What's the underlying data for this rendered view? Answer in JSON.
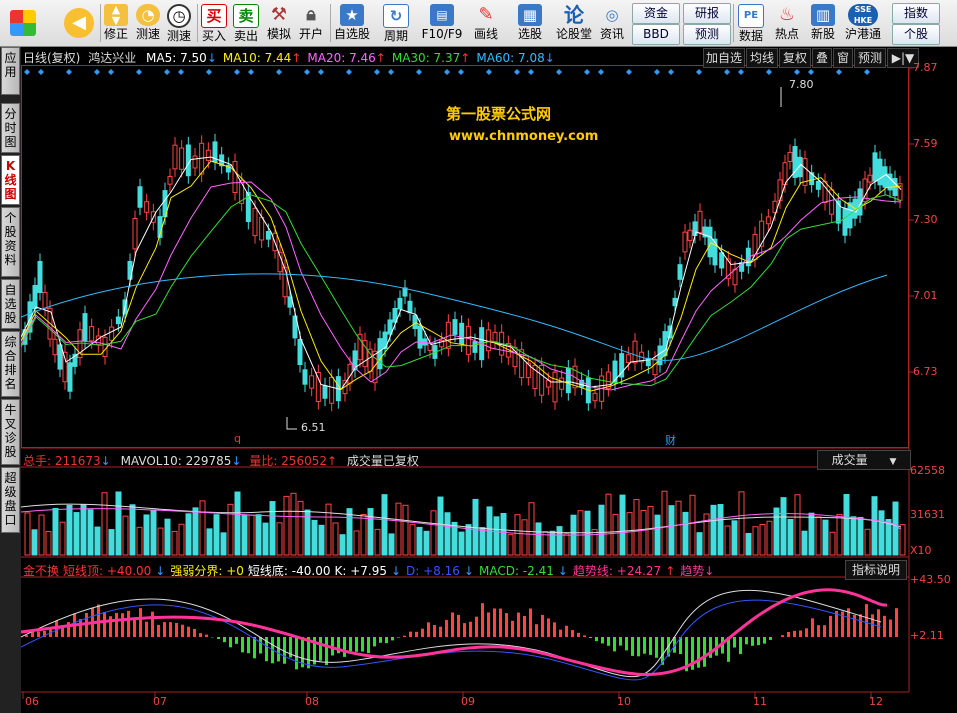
{
  "toolbar": {
    "buttons": [
      {
        "key": "back",
        "label": "",
        "icon": "back-arrow-icon"
      },
      {
        "key": "adjust",
        "label": "修正",
        "icon": "updown-arrows-icon"
      },
      {
        "key": "test",
        "label": "测速",
        "icon": "clock-icon"
      },
      {
        "key": "buy",
        "label": "买入",
        "icon": "buy-icon",
        "glyph": "买"
      },
      {
        "key": "sell",
        "label": "卖出",
        "icon": "sell-icon",
        "glyph": "卖"
      },
      {
        "key": "sim",
        "label": "模拟",
        "icon": "hammer-icon"
      },
      {
        "key": "open",
        "label": "开户",
        "icon": "lock-icon"
      },
      {
        "key": "watch",
        "label": "自选股",
        "icon": "star-folder-icon"
      },
      {
        "key": "period",
        "label": "周期",
        "icon": "cycle-icon"
      },
      {
        "key": "f10",
        "label": "F10/F9",
        "icon": "f10-icon"
      },
      {
        "key": "draw",
        "label": "画线",
        "icon": "pen-icon"
      },
      {
        "key": "pick",
        "label": "选股",
        "icon": "pick-icon"
      },
      {
        "key": "forum",
        "label": "论股堂",
        "icon": "forum-icon"
      },
      {
        "key": "info",
        "label": "资讯",
        "icon": "info-icon"
      },
      {
        "key": "data",
        "label": "数据",
        "icon": "pe-icon",
        "glyph": "PE"
      },
      {
        "key": "hot",
        "label": "热点",
        "icon": "hot-icon"
      },
      {
        "key": "ipo",
        "label": "新股",
        "icon": "news-icon"
      },
      {
        "key": "hkconnect",
        "label": "沪港通",
        "icon": "sse-hkex-icon"
      }
    ],
    "small": {
      "fund": "资金",
      "research": "研报",
      "index": "指数",
      "bbd": "BBD",
      "forecast": "预测",
      "personal": "个股"
    }
  },
  "lefttabs": [
    "应用",
    "分时图",
    "K线图",
    "个股资料",
    "自选股",
    "综合排名",
    "牛叉诊股",
    "超级盘口"
  ],
  "kline": {
    "title": "日线(复权)",
    "stock": "鸿达兴业",
    "ma": [
      {
        "label": "MA5: 7.50",
        "color": "#ffffff",
        "arrow": "down"
      },
      {
        "label": "MA10: 7.44",
        "color": "#ffee00",
        "arrow": "up"
      },
      {
        "label": "MA20: 7.46",
        "color": "#ff66ff",
        "arrow": "up"
      },
      {
        "label": "MA30: 7.37",
        "color": "#33dd33",
        "arrow": "up"
      },
      {
        "label": "MA60: 7.08",
        "color": "#33bbff",
        "arrow": "down"
      }
    ],
    "buttons": [
      "加自选",
      "均线",
      "复权",
      "叠",
      "窗",
      "预测"
    ],
    "watermark1": "第一股票公式网",
    "watermark2": "www.chnmoney.com",
    "high_label": "7.80",
    "low_label": "6.51",
    "marker_q": "q",
    "marker_cai": "财",
    "yaxis": [
      "7.87",
      "7.59",
      "7.30",
      "7.01",
      "6.73"
    ]
  },
  "volume": {
    "total": "总手: 211673",
    "mavol": "MAVOL10: 229785",
    "ratio": "量比: 256052",
    "note": "成交量已复权",
    "select": "成交量",
    "yaxis": [
      "62558",
      "31631",
      "X10"
    ]
  },
  "indicator": {
    "items": [
      {
        "label": "金不换",
        "color": "#ff3333"
      },
      {
        "label": "短线顶: +40.00",
        "color": "#ff3333",
        "arrow": "down"
      },
      {
        "label": "强弱分界: +0",
        "color": "#ffee00"
      },
      {
        "label": "短线底: -40.00",
        "color": "#ffffff"
      },
      {
        "label": "K: +7.95",
        "color": "#ffffff",
        "arrow": "down"
      },
      {
        "label": "D: +8.16",
        "color": "#3355ff",
        "arrow": "down"
      },
      {
        "label": "MACD: -2.41",
        "color": "#33dd33",
        "arrow": "down"
      },
      {
        "label": "趋势线: +24.27",
        "color": "#ff3399",
        "arrow": "up"
      },
      {
        "label": "趋势↓",
        "color": "#ff3399"
      }
    ],
    "button": "指标说明",
    "yaxis": [
      "+43.50",
      "+2.11"
    ]
  },
  "xaxis": [
    "06",
    "07",
    "08",
    "09",
    "10",
    "11",
    "12"
  ]
}
